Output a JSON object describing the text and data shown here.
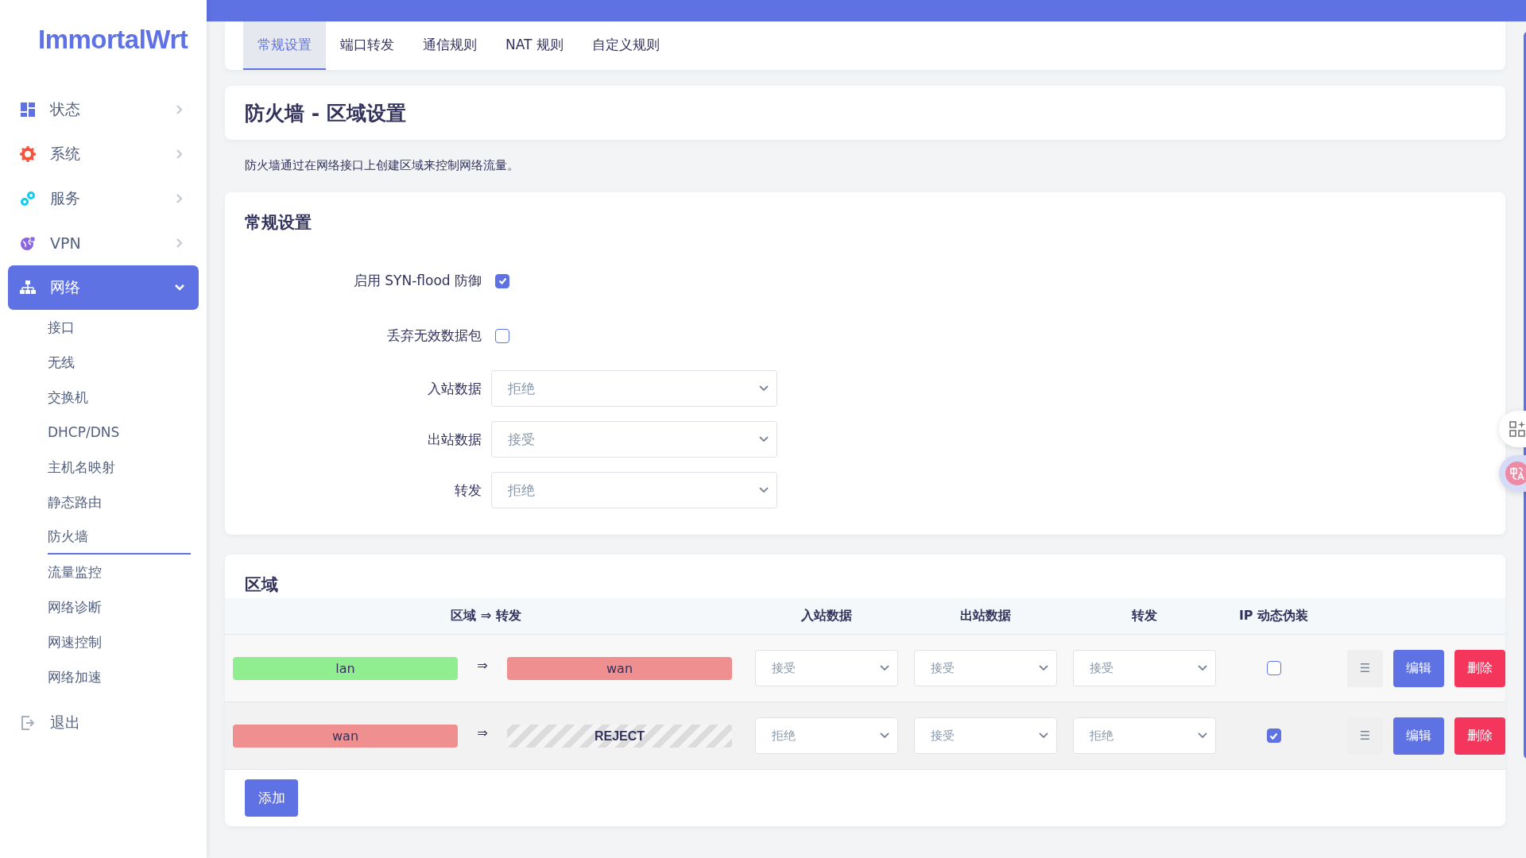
{
  "sidebar": {
    "logo": "ImmortalWrt",
    "items": [
      {
        "label": "状态",
        "expanded": false
      },
      {
        "label": "系统",
        "expanded": false
      },
      {
        "label": "服务",
        "expanded": false
      },
      {
        "label": "VPN",
        "expanded": false
      },
      {
        "label": "网络",
        "expanded": true,
        "children": [
          {
            "label": "接口",
            "selected": false
          },
          {
            "label": "无线",
            "selected": false
          },
          {
            "label": "交换机",
            "selected": false
          },
          {
            "label": "DHCP/DNS",
            "selected": false
          },
          {
            "label": "主机名映射",
            "selected": false
          },
          {
            "label": "静态路由",
            "selected": false
          },
          {
            "label": "防火墙",
            "selected": true
          },
          {
            "label": "流量监控",
            "selected": false
          },
          {
            "label": "网络诊断",
            "selected": false
          },
          {
            "label": "网速控制",
            "selected": false
          },
          {
            "label": "网络加速",
            "selected": false
          }
        ]
      }
    ],
    "logout": "退出"
  },
  "tabs": [
    {
      "label": "常规设置",
      "selected": true
    },
    {
      "label": "端口转发",
      "selected": false
    },
    {
      "label": "通信规则",
      "selected": false
    },
    {
      "label": "NAT 规则",
      "selected": false
    },
    {
      "label": "自定义规则",
      "selected": false
    }
  ],
  "page_title": "防火墙 - 区域设置",
  "description": "防火墙通过在网络接口上创建区域来控制网络流量。",
  "general": {
    "title": "常规设置",
    "fields": [
      {
        "kind": "checkbox",
        "label": "启用 SYN-flood 防御",
        "checked": true
      },
      {
        "kind": "checkbox",
        "label": "丢弃无效数据包",
        "checked": false
      },
      {
        "kind": "select",
        "label": "入站数据",
        "value": "拒绝"
      },
      {
        "kind": "select",
        "label": "出站数据",
        "value": "接受"
      },
      {
        "kind": "select",
        "label": "转发",
        "value": "拒绝"
      }
    ]
  },
  "zones": {
    "title": "区域",
    "columns": [
      "区域 ⇒ 转发",
      "入站数据",
      "出站数据",
      "转发",
      "IP 动态伪装"
    ],
    "rows": [
      {
        "zone": {
          "kind": "zone",
          "name": "lan",
          "color": "#90ee90"
        },
        "arrow": "⇒",
        "forward": {
          "kind": "zone",
          "name": "wan",
          "color": "#f08f8f"
        },
        "input": "接受",
        "output": "接受",
        "forwarding": "接受",
        "masquerade": false,
        "handle": "☰",
        "edit": "编辑",
        "delete": "删除"
      },
      {
        "zone": {
          "kind": "zone",
          "name": "wan",
          "color": "#f08f8f"
        },
        "arrow": "⇒",
        "forward": {
          "kind": "reject",
          "name": "REJECT"
        },
        "input": "拒绝",
        "output": "接受",
        "forwarding": "拒绝",
        "masquerade": true,
        "handle": "☰",
        "edit": "编辑",
        "delete": "删除"
      }
    ],
    "add": "添加"
  }
}
